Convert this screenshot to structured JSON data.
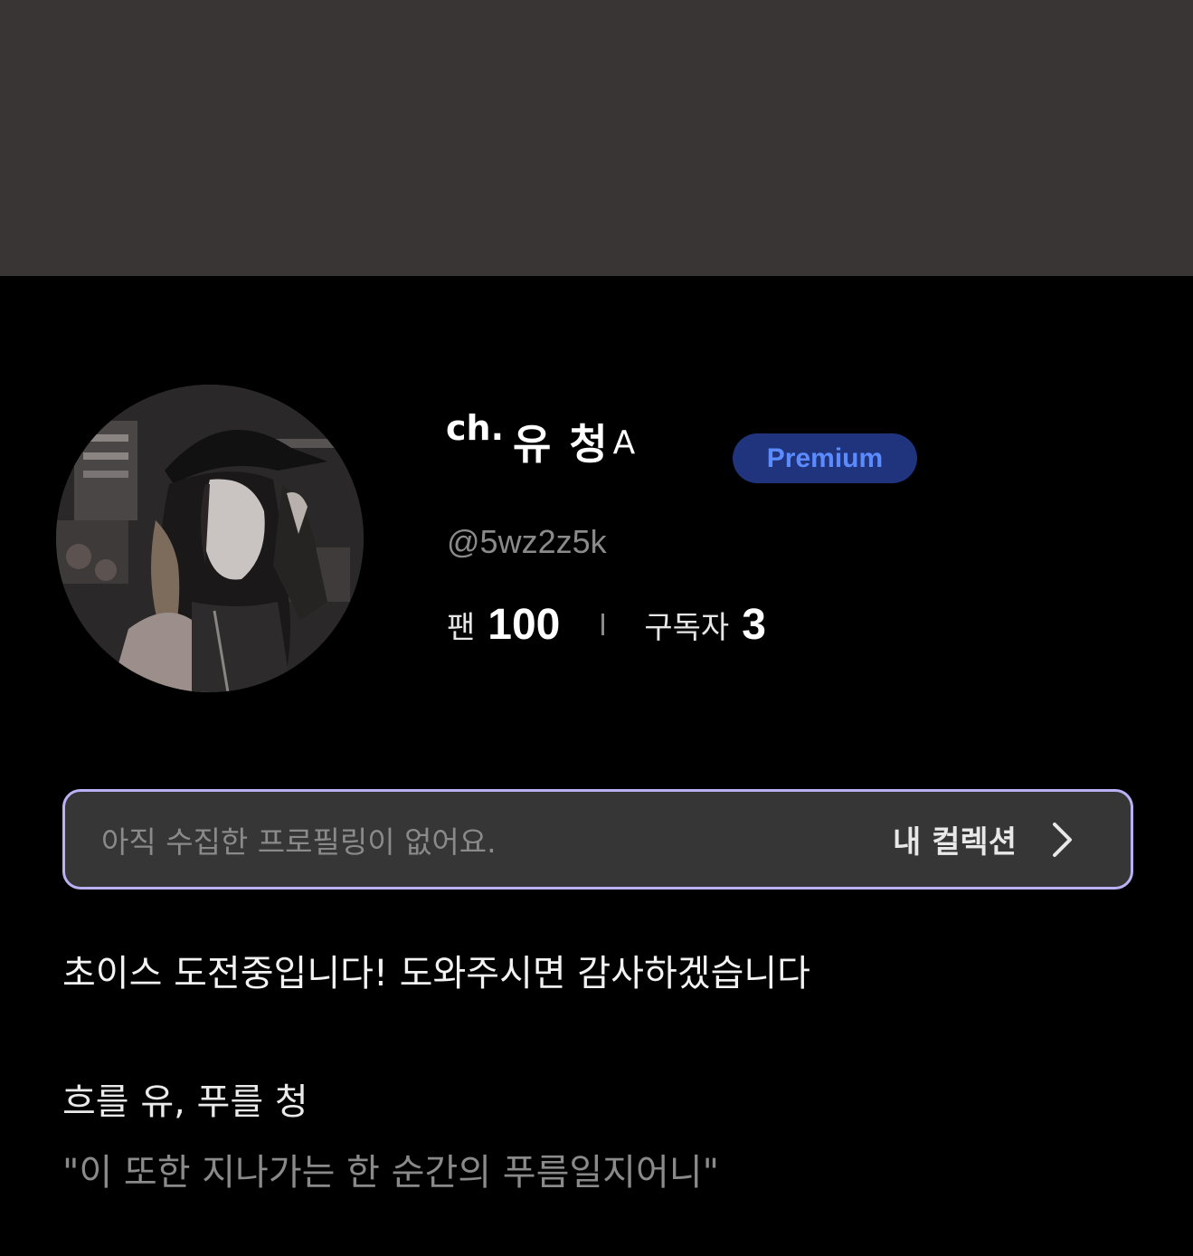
{
  "banner": {
    "color": "#393534"
  },
  "profile": {
    "channel_prefix": "ch.",
    "channel_name": "유 청",
    "channel_deco": "A",
    "badge": "Premium",
    "handle": "@5wz2z5k",
    "stats": {
      "fans_label": "팬",
      "fans_value": "100",
      "subscribers_label": "구독자",
      "subscribers_value": "3"
    }
  },
  "collection": {
    "empty_text": "아직 수집한 프로필링이 없어요.",
    "link_label": "내 컬렉션",
    "border_color": "#b8b1f5"
  },
  "bio": {
    "line1": "초이스 도전중입니다! 도와주시면 감사하겠습니다",
    "line2": "흐를 유, 푸를 청",
    "line3": "\"이 또한 지나가는 한 순간의 푸름일지어니\""
  },
  "colors": {
    "background": "#000000",
    "premium_bg": "#1f347d",
    "premium_text": "#5b8bff",
    "muted_text": "#8a8a8a"
  },
  "icons": {
    "avatar": "profile-photo",
    "chevron": "chevron-right-icon"
  }
}
